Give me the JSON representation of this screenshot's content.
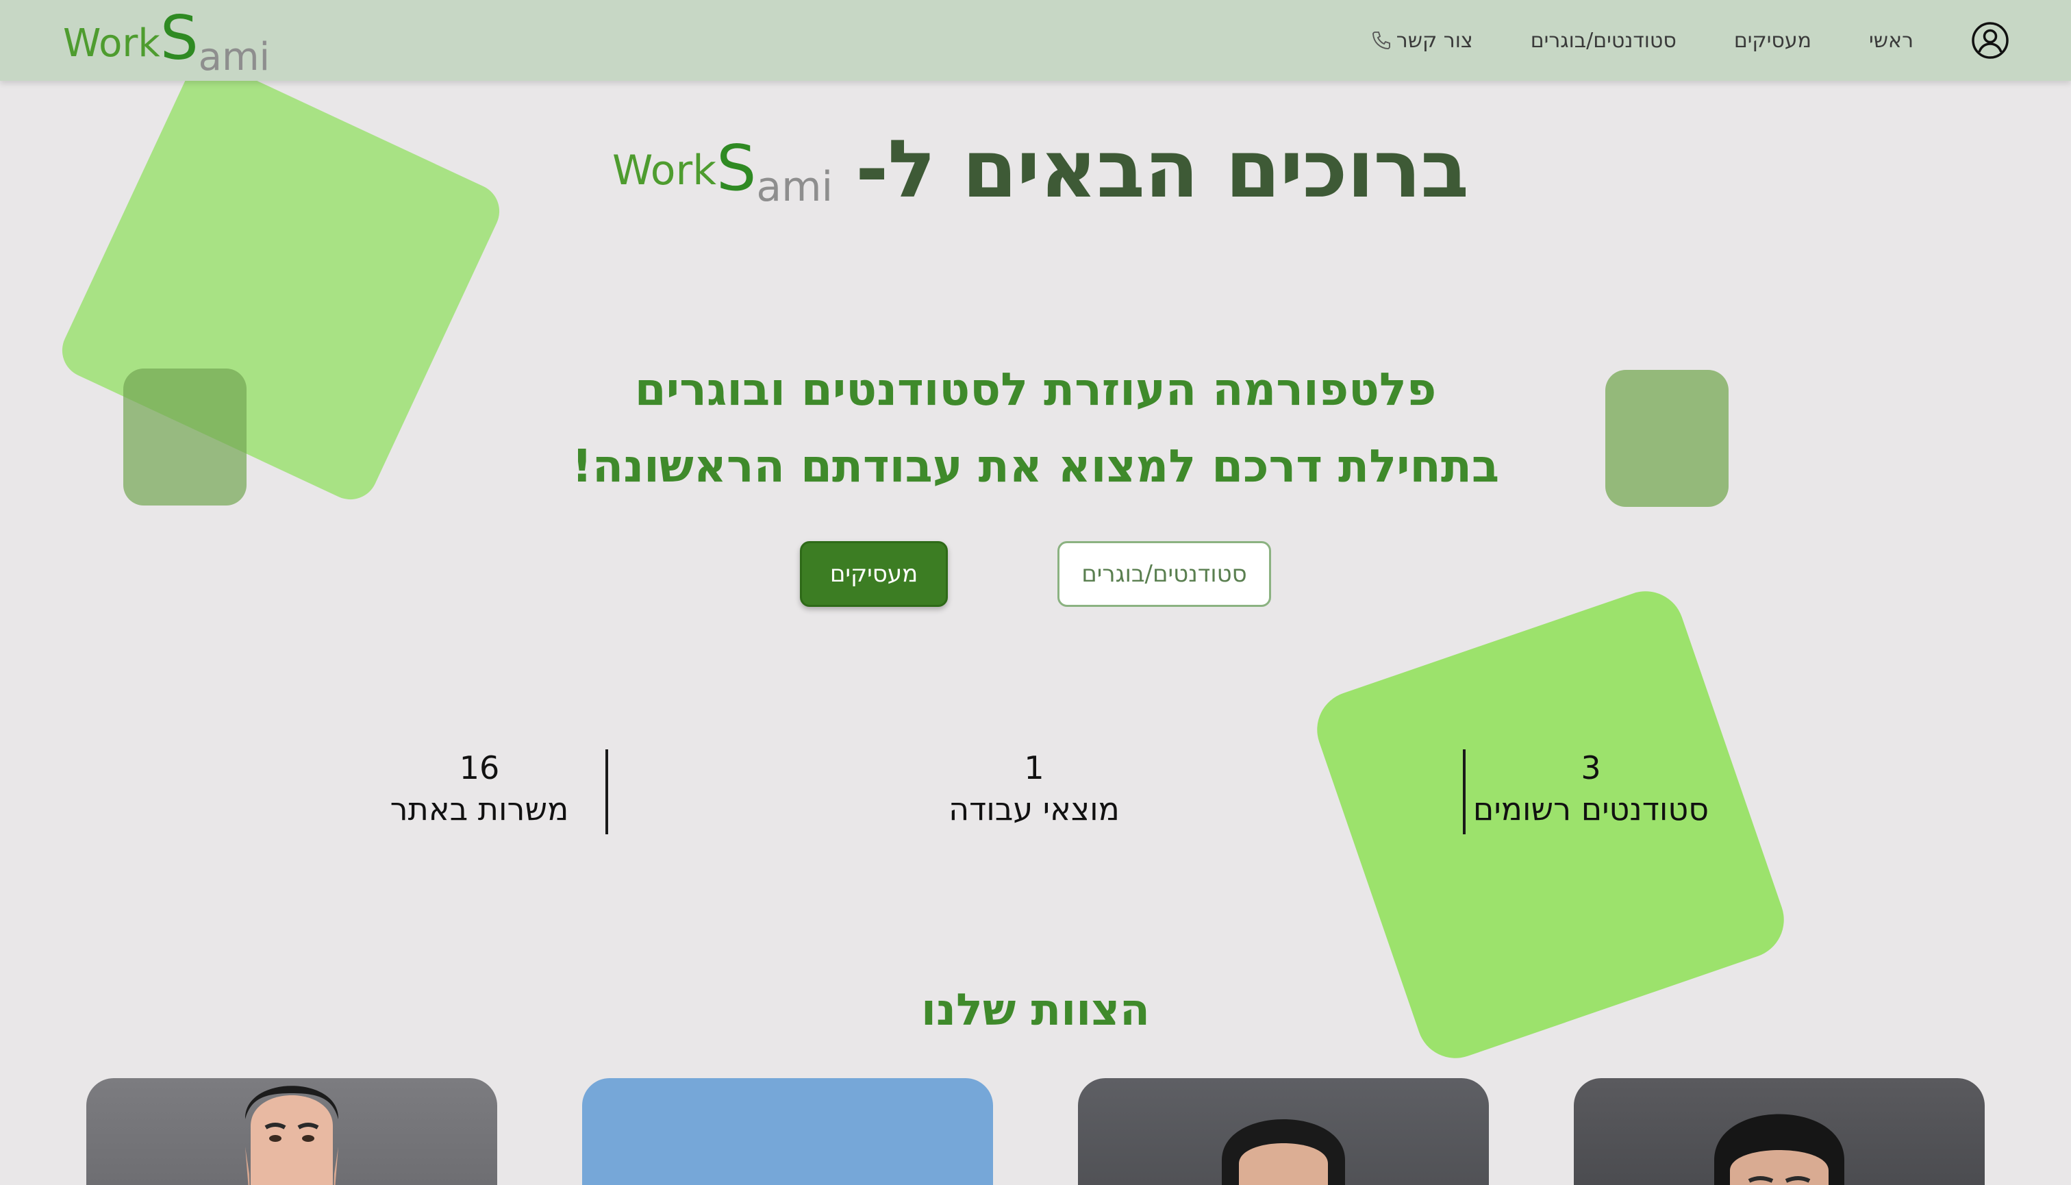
{
  "brand": {
    "work": "Work",
    "s": "S",
    "ami": "ami"
  },
  "nav": {
    "contact_label": "צור קשר",
    "students_label": "סטודנטים/בוגרים",
    "employers_label": "מעסיקים",
    "home_label": "ראשי"
  },
  "hero": {
    "title": "ברוכים הבאים ל-",
    "subtitle_line1": "פלטפורמה העוזרת לסטודנטים ובוגרים",
    "subtitle_line2": "בתחילת דרכם למצוא את עבודתם הראשונה!",
    "employers_button": "מעסיקים",
    "students_button": "סטודנטים/בוגרים"
  },
  "stats": [
    {
      "value": "3",
      "label": "סטודנטים רשומים"
    },
    {
      "value": "1",
      "label": "מוצאי עבודה"
    },
    {
      "value": "16",
      "label": "משרות באתר"
    }
  ],
  "team": {
    "title": "הצוות שלנו"
  },
  "colors": {
    "navbar": "#c7d7c5",
    "background": "#e9e7e8",
    "brand_green": "#3f8a2b",
    "primary_button": "#3c7d23",
    "hero_title": "#3e5a36"
  },
  "icons": {
    "contact": "phone-icon",
    "account": "user-circle-icon"
  }
}
